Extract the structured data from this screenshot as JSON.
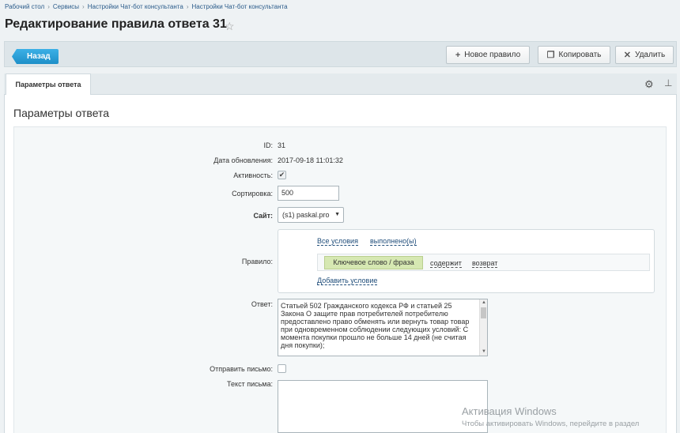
{
  "breadcrumbs": [
    "Рабочий стол",
    "Сервисы",
    "Настройки Чат-бот консультанта",
    "Настройки Чат-бот консультанта"
  ],
  "page": {
    "title": "Редактирование правила ответа 31"
  },
  "toolbar": {
    "back_label": "Назад",
    "new_rule_label": "Новое правило",
    "copy_label": "Копировать",
    "delete_label": "Удалить"
  },
  "tabs": [
    {
      "label": "Параметры ответа",
      "active": true
    }
  ],
  "section": {
    "title": "Параметры ответа"
  },
  "form": {
    "id_label": "ID:",
    "id_value": "31",
    "updated_label": "Дата обновления:",
    "updated_value": "2017-09-18 11:01:32",
    "active_label": "Активность:",
    "active_checked": true,
    "sort_label": "Сортировка:",
    "sort_value": "500",
    "site_label": "Сайт:",
    "site_value": "(s1) paskal.pro",
    "rule_label": "Правило:",
    "rule": {
      "all_conditions": "Все условия",
      "fulfilled": "выполнено(ы)",
      "condition_type": "Ключевое слово / фраза",
      "operator": "содержит",
      "value": "возврат",
      "add_condition": "Добавить условие"
    },
    "answer_label": "Ответ:",
    "answer_text": "Статьей 502 Гражданского кодекса РФ и статьей 25 Закона О защите прав потребителей потребителю предоставлено право обменять или вернуть товар товар при одновременном соблюдении следующих условий: С момента покупки прошло не больше 14 дней (не считая дня покупки);",
    "send_letter_label": "Отправить письмо:",
    "send_letter_checked": false,
    "letter_text_label": "Текст письма:",
    "letter_text_value": ""
  },
  "watermark": {
    "line1": "Активация Windows",
    "line2": "Чтобы активировать Windows, перейдите в раздел"
  },
  "colors": {
    "accent": "#1e8fc8",
    "chip": "#d6e8b2",
    "link": "#1f4d7a"
  }
}
